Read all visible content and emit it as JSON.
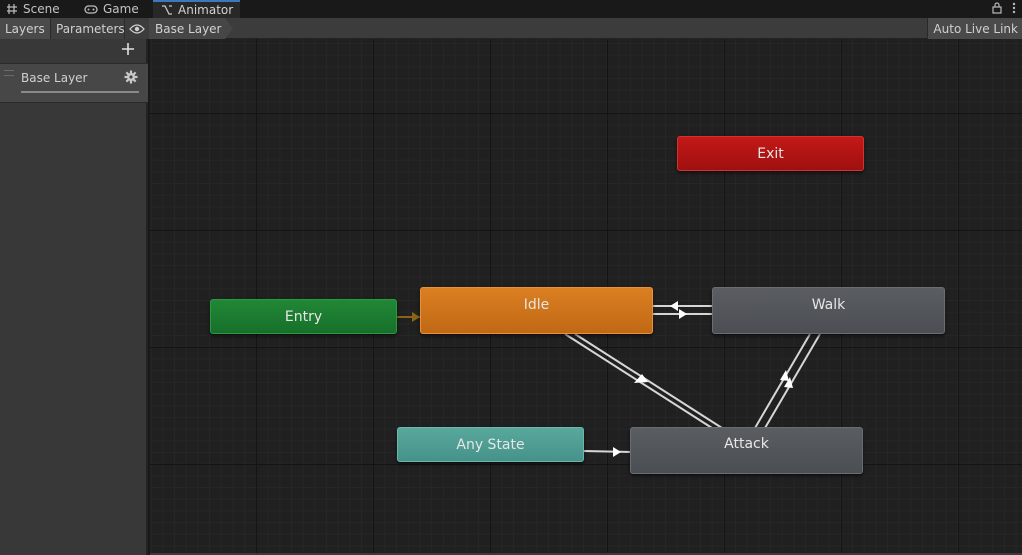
{
  "tabs": [
    {
      "label": "Scene",
      "icon": "grid-icon"
    },
    {
      "label": "Game",
      "icon": "gamepad-icon"
    },
    {
      "label": "Animator",
      "icon": "animator-icon"
    }
  ],
  "toolbar": {
    "layers_label": "Layers",
    "parameters_label": "Parameters",
    "breadcrumb": "Base Layer",
    "auto_live_link_label": "Auto Live Link"
  },
  "layers_panel": {
    "layers": [
      {
        "name": "Base Layer"
      }
    ]
  },
  "states": {
    "entry": {
      "label": "Entry",
      "color": "#1d7a2f"
    },
    "exit": {
      "label": "Exit",
      "color": "#b71414"
    },
    "any_state": {
      "label": "Any State",
      "color": "#4f9f94"
    },
    "idle": {
      "label": "Idle",
      "color": "#d2761c",
      "default": true
    },
    "walk": {
      "label": "Walk",
      "color": "#52555a"
    },
    "attack": {
      "label": "Attack",
      "color": "#52555a"
    }
  },
  "transitions": [
    {
      "from": "Entry",
      "to": "Idle"
    },
    {
      "from": "Walk",
      "to": "Idle"
    },
    {
      "from": "Idle",
      "to": "Walk"
    },
    {
      "from": "Idle",
      "to": "Attack"
    },
    {
      "from": "Attack",
      "to": "Idle"
    },
    {
      "from": "Attack",
      "to": "Walk"
    },
    {
      "from": "Walk",
      "to": "Attack"
    },
    {
      "from": "Any State",
      "to": "Attack"
    }
  ]
}
